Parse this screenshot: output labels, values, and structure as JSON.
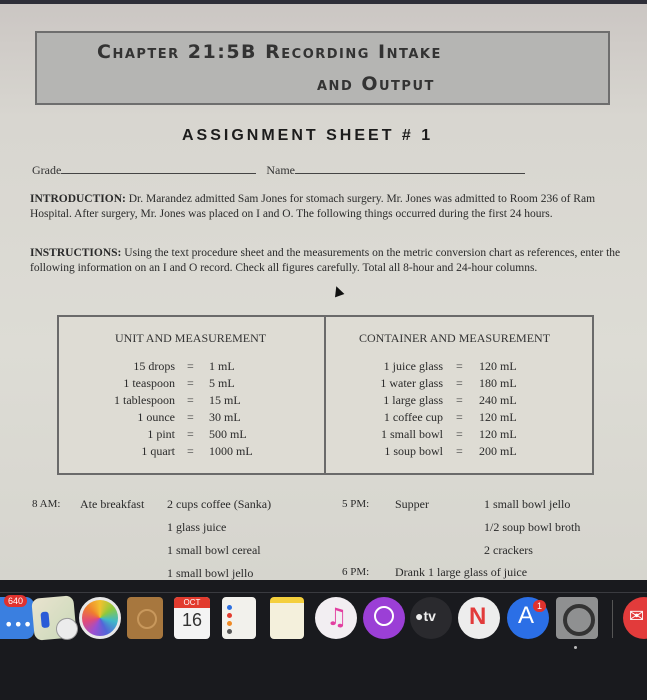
{
  "document": {
    "chapter_title_line1": "Chapter 21:5B Recording Intake",
    "chapter_title_line2": "and Output",
    "assignment_title": "ASSIGNMENT SHEET # 1",
    "grade_label": "Grade",
    "name_label": "Name",
    "introduction_label": "INTRODUCTION:",
    "introduction_text": " Dr. Marandez admitted Sam Jones for stomach surgery.  Mr. Jones was admitted to Room 236 of Ram Hospital. After surgery, Mr. Jones was placed on I and O. The following things occurred during the first 24 hours.",
    "instructions_label": "INSTRUCTIONS:",
    "instructions_text": " Using the text procedure sheet and the measurements on the metric conversion chart as references, enter the following information on an I and O record. Check all figures carefully. Total all 8-hour and 24-hour columns."
  },
  "conversion_table": {
    "unit_header": "UNIT AND MEASUREMENT",
    "container_header": "CONTAINER AND MEASUREMENT",
    "equals": "=",
    "units": [
      {
        "unit": "15 drops",
        "value": "1 mL"
      },
      {
        "unit": "1 teaspoon",
        "value": "5 mL"
      },
      {
        "unit": "1 tablespoon",
        "value": "15 mL"
      },
      {
        "unit": "1 ounce",
        "value": "30 mL"
      },
      {
        "unit": "1 pint",
        "value": "500 mL"
      },
      {
        "unit": "1 quart",
        "value": "1000 mL"
      }
    ],
    "containers": [
      {
        "container": "1 juice glass",
        "value": "120 mL"
      },
      {
        "container": "1 water glass",
        "value": "180 mL"
      },
      {
        "container": "1 large glass",
        "value": "240 mL"
      },
      {
        "container": "1 coffee cup",
        "value": "120 mL"
      },
      {
        "container": "1 small bowl",
        "value": "120 mL"
      },
      {
        "container": "1 soup bowl",
        "value": "200 mL"
      }
    ]
  },
  "events": {
    "breakfast": {
      "time": "8 AM:",
      "activity": "Ate breakfast",
      "items": [
        "2 cups coffee (Sanka)",
        "1 glass juice",
        "1 small bowl cereal",
        "1 small bowl jello"
      ]
    },
    "supper": {
      "time": "5 PM:",
      "activity": "Supper",
      "items": [
        "1 small bowl jello",
        "1/2 soup bowl broth",
        "2 crackers"
      ]
    },
    "juice": {
      "time": "6 PM:",
      "activity": "Drank 1 large glass of juice"
    }
  },
  "dock": {
    "apps": [
      {
        "name": "Messages",
        "badge": "640"
      },
      {
        "name": "Maps"
      },
      {
        "name": "Photos"
      },
      {
        "name": "Contacts"
      },
      {
        "name": "Calendar",
        "month": "OCT",
        "day": "16"
      },
      {
        "name": "Reminders"
      },
      {
        "name": "Notes"
      },
      {
        "name": "Music"
      },
      {
        "name": "Podcasts"
      },
      {
        "name": "TV",
        "label": "tv"
      },
      {
        "name": "News"
      },
      {
        "name": "App Store",
        "badge": "1"
      },
      {
        "name": "System Preferences"
      },
      {
        "name": "Mail"
      }
    ]
  }
}
